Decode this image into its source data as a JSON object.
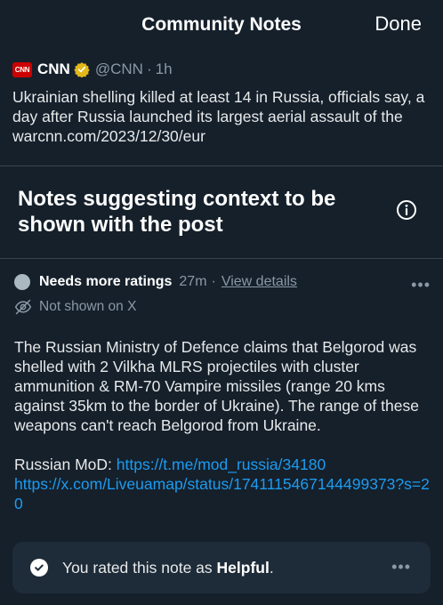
{
  "header": {
    "title": "Community Notes",
    "done_label": "Done"
  },
  "tweet": {
    "logo_text": "CNN",
    "author_name": "CNN",
    "handle": "@CNN",
    "separator": "·",
    "time": "1h",
    "text": "Ukrainian shelling killed at least 14 in Russia, officials say, a day after Russia launched its largest aerial assault of the warcnn.com/2023/12/30/eur"
  },
  "notes_section": {
    "heading": "Notes suggesting context to be shown with the post"
  },
  "note": {
    "status": "Needs more ratings",
    "time": "27m",
    "separator": "·",
    "view_details": "View details",
    "visibility": "Not shown on X",
    "body": "The Russian Ministry of Defence claims that Belgorod was shelled with 2 Vilkha MLRS projectiles with cluster ammunition & RM-70 Vampire missiles (range 20 kms against 35km to the border of Ukraine). The range of these weapons can't reach Belgorod from Ukraine.",
    "source_label": "Russian MoD:",
    "link1": "https://t.me/mod_russia/34180",
    "link2": "https://x.com/Liveuamap/status/1741115467144499373?s=20"
  },
  "rating": {
    "prefix": "You rated this note as",
    "value": "Helpful",
    "suffix": "."
  },
  "colors": {
    "background": "#15202b",
    "link": "#1d9bf0",
    "muted": "#8b98a5",
    "brand_red": "#cc0000",
    "verified_gold": "#e2b719"
  }
}
